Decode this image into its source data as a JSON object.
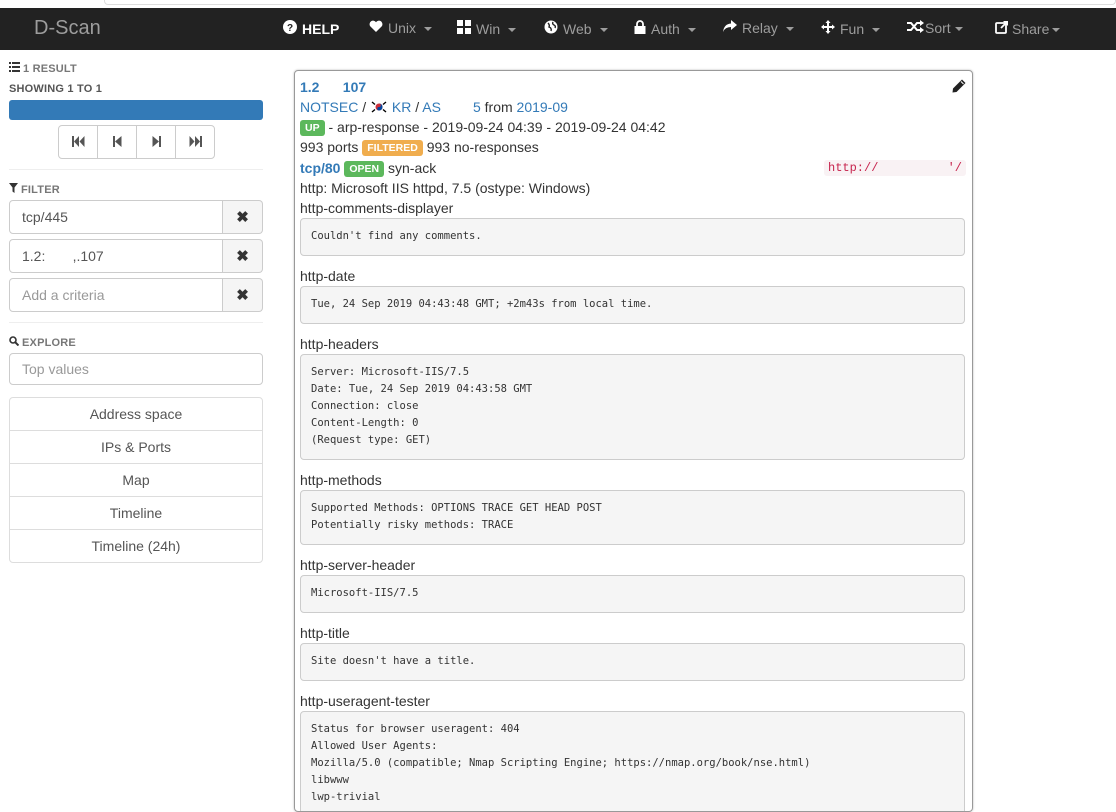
{
  "navbar": {
    "brand": "D-Scan",
    "items": [
      {
        "label": "HELP",
        "icon": "question-circle-icon"
      },
      {
        "label": "Unix",
        "icon": "heart-icon"
      },
      {
        "label": "Win",
        "icon": "windows-icon"
      },
      {
        "label": "Web",
        "icon": "globe-icon"
      },
      {
        "label": "Auth",
        "icon": "lock-icon"
      },
      {
        "label": "Relay",
        "icon": "share-arrow-icon"
      },
      {
        "label": "Fun",
        "icon": "move-icon"
      },
      {
        "label": "Sort",
        "icon": "random-icon"
      },
      {
        "label": "Share",
        "icon": "export-icon"
      }
    ]
  },
  "sidebar": {
    "result_count": "1 RESULT",
    "showing": "SHOWING 1 TO 1",
    "progress": 1.0,
    "filter_heading": "FILTER",
    "filters": [
      {
        "value": "tcp/445"
      },
      {
        "value": "1.2:       ,.107"
      }
    ],
    "add_criteria_placeholder": "Add a criteria",
    "explore_heading": "EXPLORE",
    "top_values_placeholder": "Top values",
    "explore_links": [
      "Address space",
      "IPs & Ports",
      "Map",
      "Timeline",
      "Timeline (24h)"
    ]
  },
  "host": {
    "ip": "1.2      107",
    "org": "NOTSEC",
    "country": "KR",
    "as_prefix": "AS",
    "as_number": "5",
    "from_text": "from",
    "from_date": "2019-09",
    "status": "UP",
    "status_reason": "- arp-response - 2019-09-24 04:39 - 2019-09-24 04:42",
    "ports_count": "993 ports",
    "filtered_label": "FILTERED",
    "filtered_text": "993 no-responses",
    "port": "tcp/80",
    "port_state": "OPEN",
    "port_reason": "syn-ack",
    "url_prefix": "http://",
    "url_suffix": "'/",
    "service": "http: Microsoft IIS httpd, 7.5 (ostype: Windows)"
  },
  "scripts": [
    {
      "name": "http-comments-displayer",
      "output": "Couldn't find any comments."
    },
    {
      "name": "http-date",
      "output": "Tue, 24 Sep 2019 04:43:48 GMT; +2m43s from local time."
    },
    {
      "name": "http-headers",
      "output": "Server: Microsoft-IIS/7.5\nDate: Tue, 24 Sep 2019 04:43:58 GMT\nConnection: close\nContent-Length: 0\n(Request type: GET)"
    },
    {
      "name": "http-methods",
      "output": "Supported Methods: OPTIONS TRACE GET HEAD POST\nPotentially risky methods: TRACE"
    },
    {
      "name": "http-server-header",
      "output": "Microsoft-IIS/7.5"
    },
    {
      "name": "http-title",
      "output": "Site doesn't have a title."
    },
    {
      "name": "http-useragent-tester",
      "output": "Status for browser useragent: 404\nAllowed User Agents:\nMozilla/5.0 (compatible; Nmap Scripting Engine; https://nmap.org/book/nse.html)\nlibwww\nlwp-trivial"
    }
  ]
}
